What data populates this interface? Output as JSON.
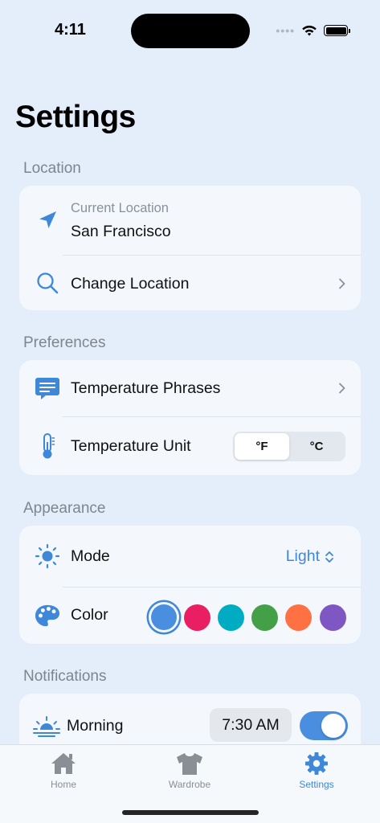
{
  "status_bar": {
    "time": "4:11"
  },
  "page": {
    "title": "Settings"
  },
  "sections": {
    "location": {
      "header": "Location",
      "current_label": "Current Location",
      "current_value": "San Francisco",
      "change_label": "Change Location"
    },
    "preferences": {
      "header": "Preferences",
      "phrases_label": "Temperature Phrases",
      "unit_label": "Temperature Unit",
      "unit_options": [
        "°F",
        "°C"
      ],
      "unit_selected": "°F"
    },
    "appearance": {
      "header": "Appearance",
      "mode_label": "Mode",
      "mode_value": "Light",
      "color_label": "Color",
      "colors": [
        "#4a8ee0",
        "#e91e63",
        "#00acc1",
        "#43a047",
        "#ff7043",
        "#7e57c2"
      ],
      "selected_color": "#4a8ee0"
    },
    "notifications": {
      "header": "Notifications",
      "morning_label": "Morning",
      "morning_time": "7:30 AM",
      "morning_enabled": true
    }
  },
  "tab_bar": {
    "tabs": [
      {
        "label": "Home",
        "icon": "house-icon"
      },
      {
        "label": "Wardrobe",
        "icon": "tshirt-icon"
      },
      {
        "label": "Settings",
        "icon": "gear-icon"
      }
    ],
    "active": "Settings"
  },
  "colors": {
    "accent": "#3f87d9",
    "background": "#e3eefa",
    "card": "#f4f8fc"
  }
}
